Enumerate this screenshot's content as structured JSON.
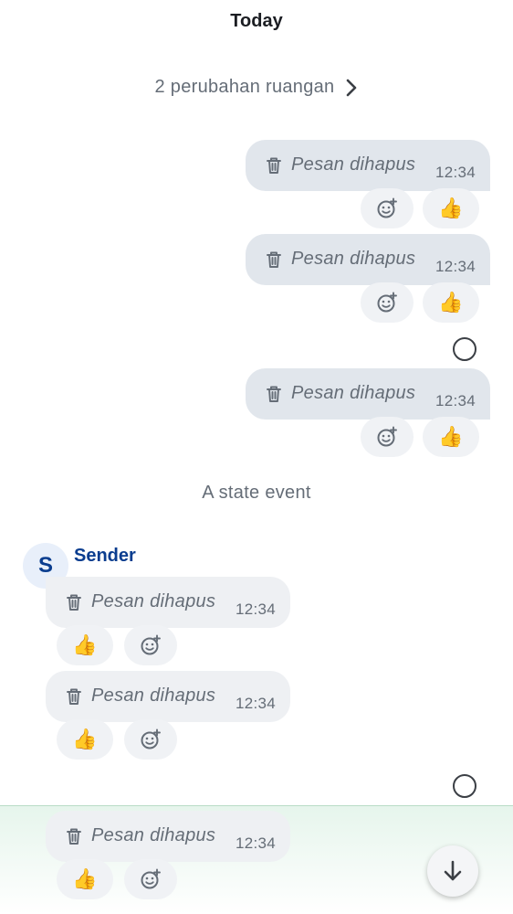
{
  "timeline": {
    "day_header": "Today",
    "room_changes": "2 perubahan ruangan",
    "state_event": "A state event",
    "sender_name": "Sender",
    "sender_initial": "S"
  },
  "messages": [
    {
      "direction": "outgoing",
      "text": "Pesan dihapus",
      "time": "12:34",
      "reactions": [
        "add-reaction",
        "👍"
      ]
    },
    {
      "direction": "outgoing",
      "text": "Pesan dihapus",
      "time": "12:34",
      "reactions": [
        "add-reaction",
        "👍"
      ]
    },
    {
      "direction": "outgoing",
      "text": "Pesan dihapus",
      "time": "12:34",
      "reactions": [
        "add-reaction",
        "👍"
      ]
    },
    {
      "direction": "incoming",
      "text": "Pesan dihapus",
      "time": "12:34",
      "reactions": [
        "👍",
        "add-reaction"
      ]
    },
    {
      "direction": "incoming",
      "text": "Pesan dihapus",
      "time": "12:34",
      "reactions": [
        "👍",
        "add-reaction"
      ]
    },
    {
      "direction": "incoming",
      "text": "Pesan dihapus",
      "time": "12:34",
      "reactions": [
        "👍",
        "add-reaction"
      ]
    }
  ],
  "icons": {
    "deleted": "trash-icon",
    "add_reaction": "add-reaction-icon",
    "read_receipt": "read-receipt-icon",
    "scroll_down": "arrow-down-icon",
    "chevron": "chevron-right-icon"
  },
  "colors": {
    "sender_name": "#0a3d8f",
    "bubble_outgoing": "#e1e6ec",
    "bubble_incoming": "#eef0f3",
    "secondary_text": "#656d77",
    "reaction_pill": "#f0f2f5",
    "composer_tint": "#e6f5ec"
  }
}
